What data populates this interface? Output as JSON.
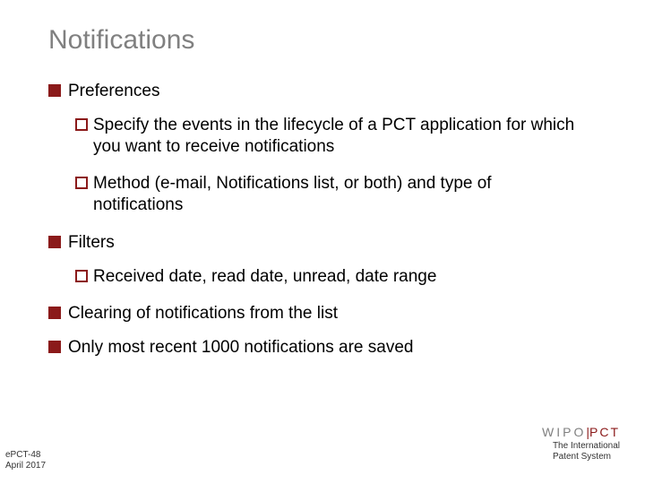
{
  "title": "Notifications",
  "bullets": {
    "b1": "Preferences",
    "b1_sub1": "Specify the events in the lifecycle of a PCT application for which you want to receive notifications",
    "b1_sub2": "Method (e-mail, Notifications list, or both) and type of notifications",
    "b2": "Filters",
    "b2_sub1": "Received date, read date, unread, date range",
    "b3": "Clearing of notifications from the list",
    "b4": "Only most recent 1000 notifications are saved"
  },
  "footer": {
    "ref": "ePCT-48",
    "date": "April 2017",
    "brand_left": "WIPO",
    "brand_right": "PCT",
    "tagline1": "The International",
    "tagline2": "Patent System"
  }
}
